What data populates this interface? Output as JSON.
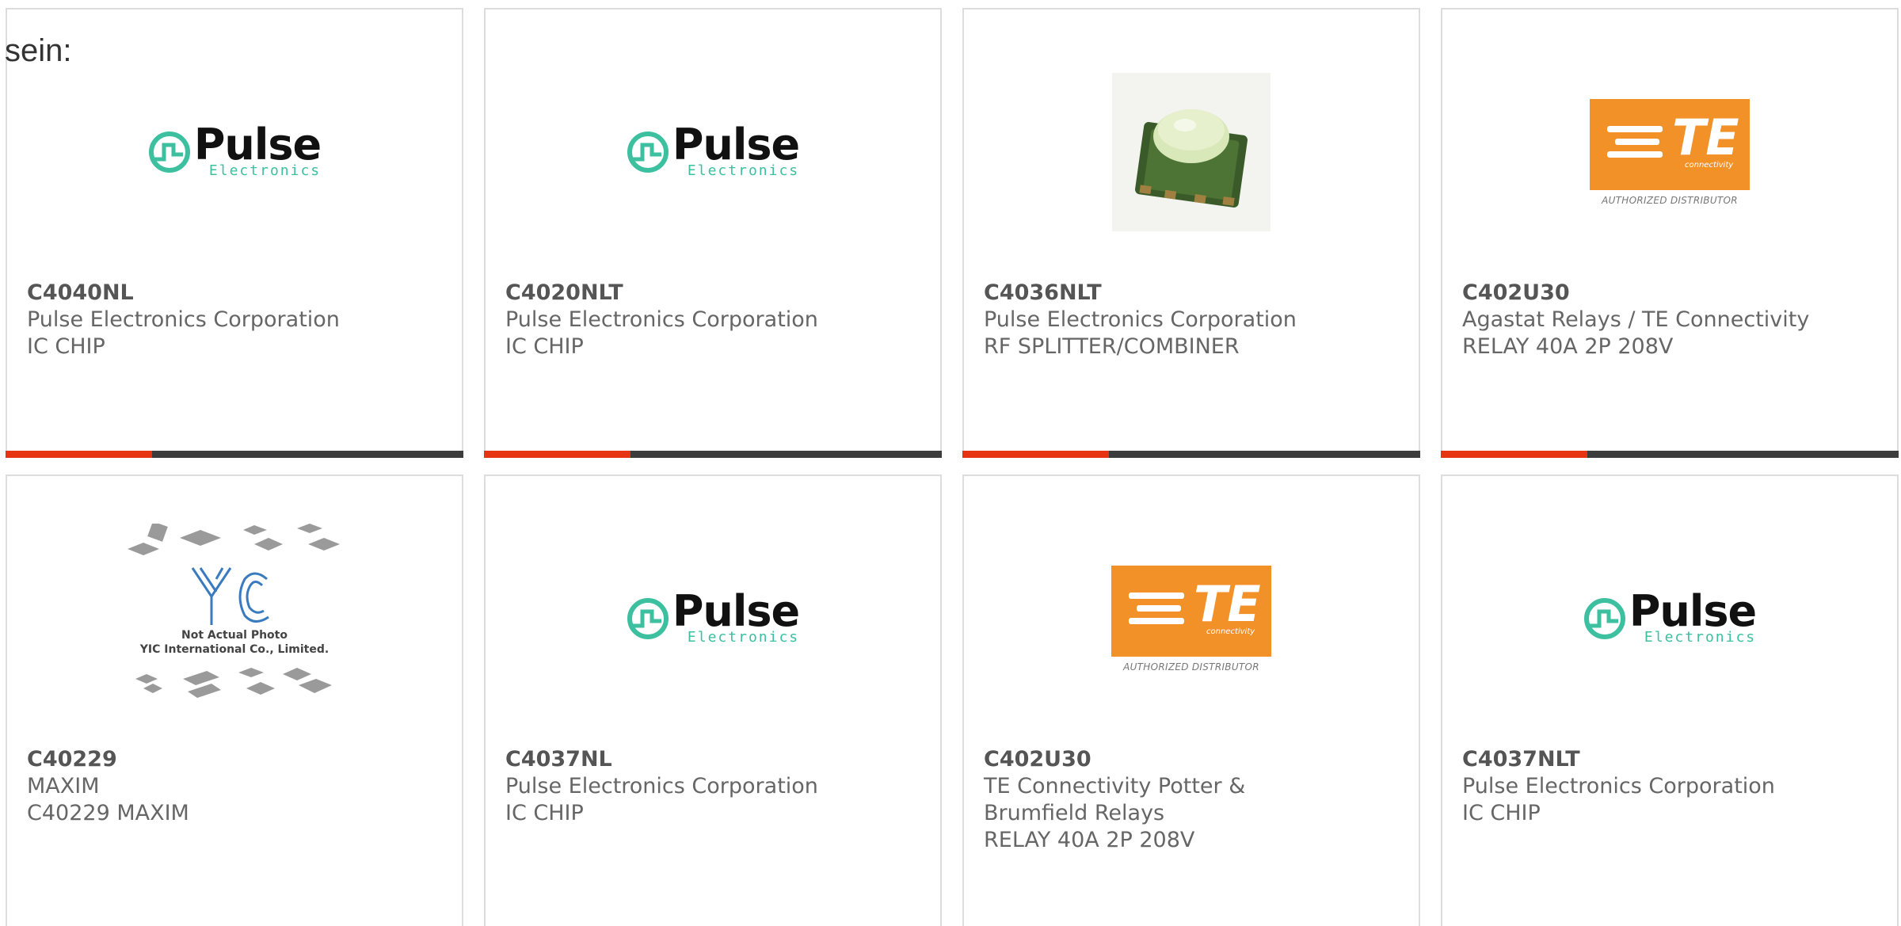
{
  "intro_text": "sein:",
  "colors": {
    "progress_fill": "#e63312",
    "progress_track": "#3c3c3c",
    "pulse_teal": "#3cc0a0",
    "te_orange": "#f39129"
  },
  "products": [
    {
      "part_number": "C4040NL",
      "manufacturer": "Pulse Electronics Corporation",
      "description": "IC CHIP",
      "image": "pulse-electronics-logo",
      "progress": 0.32
    },
    {
      "part_number": "C4020NLT",
      "manufacturer": "Pulse Electronics Corporation",
      "description": "IC CHIP",
      "image": "pulse-electronics-logo",
      "progress": 0.32
    },
    {
      "part_number": "C4036NLT",
      "manufacturer": "Pulse Electronics Corporation",
      "description": "RF SPLITTER/COMBINER",
      "image": "rf-splitter-product-photo",
      "progress": 0.32
    },
    {
      "part_number": "C402U30",
      "manufacturer": "Agastat Relays / TE Connectivity",
      "description": "RELAY 40A 2P 208V",
      "image": "te-connectivity-logo",
      "progress": 0.32
    },
    {
      "part_number": "C40229",
      "manufacturer": "MAXIM",
      "description": "C40229 MAXIM",
      "image": "yic-not-actual-photo"
    },
    {
      "part_number": "C4037NL",
      "manufacturer": "Pulse Electronics Corporation",
      "description": "IC CHIP",
      "image": "pulse-electronics-logo"
    },
    {
      "part_number": "C402U30",
      "manufacturer_line1": "TE Connectivity Potter &",
      "manufacturer_line2": "Brumfield Relays",
      "description": "RELAY 40A 2P 208V",
      "image": "te-connectivity-logo"
    },
    {
      "part_number": "C4037NLT",
      "manufacturer": "Pulse Electronics Corporation",
      "description": "IC CHIP",
      "image": "pulse-electronics-logo"
    }
  ],
  "logos": {
    "pulse_word": "Pulse",
    "pulse_sub": "Electronics",
    "te_letters": "TE",
    "te_small": "connectivity",
    "te_caption": "AUTHORIZED DISTRIBUTOR",
    "yic_line1": "Not Actual Photo",
    "yic_line2": "YIC International Co., Limited."
  }
}
